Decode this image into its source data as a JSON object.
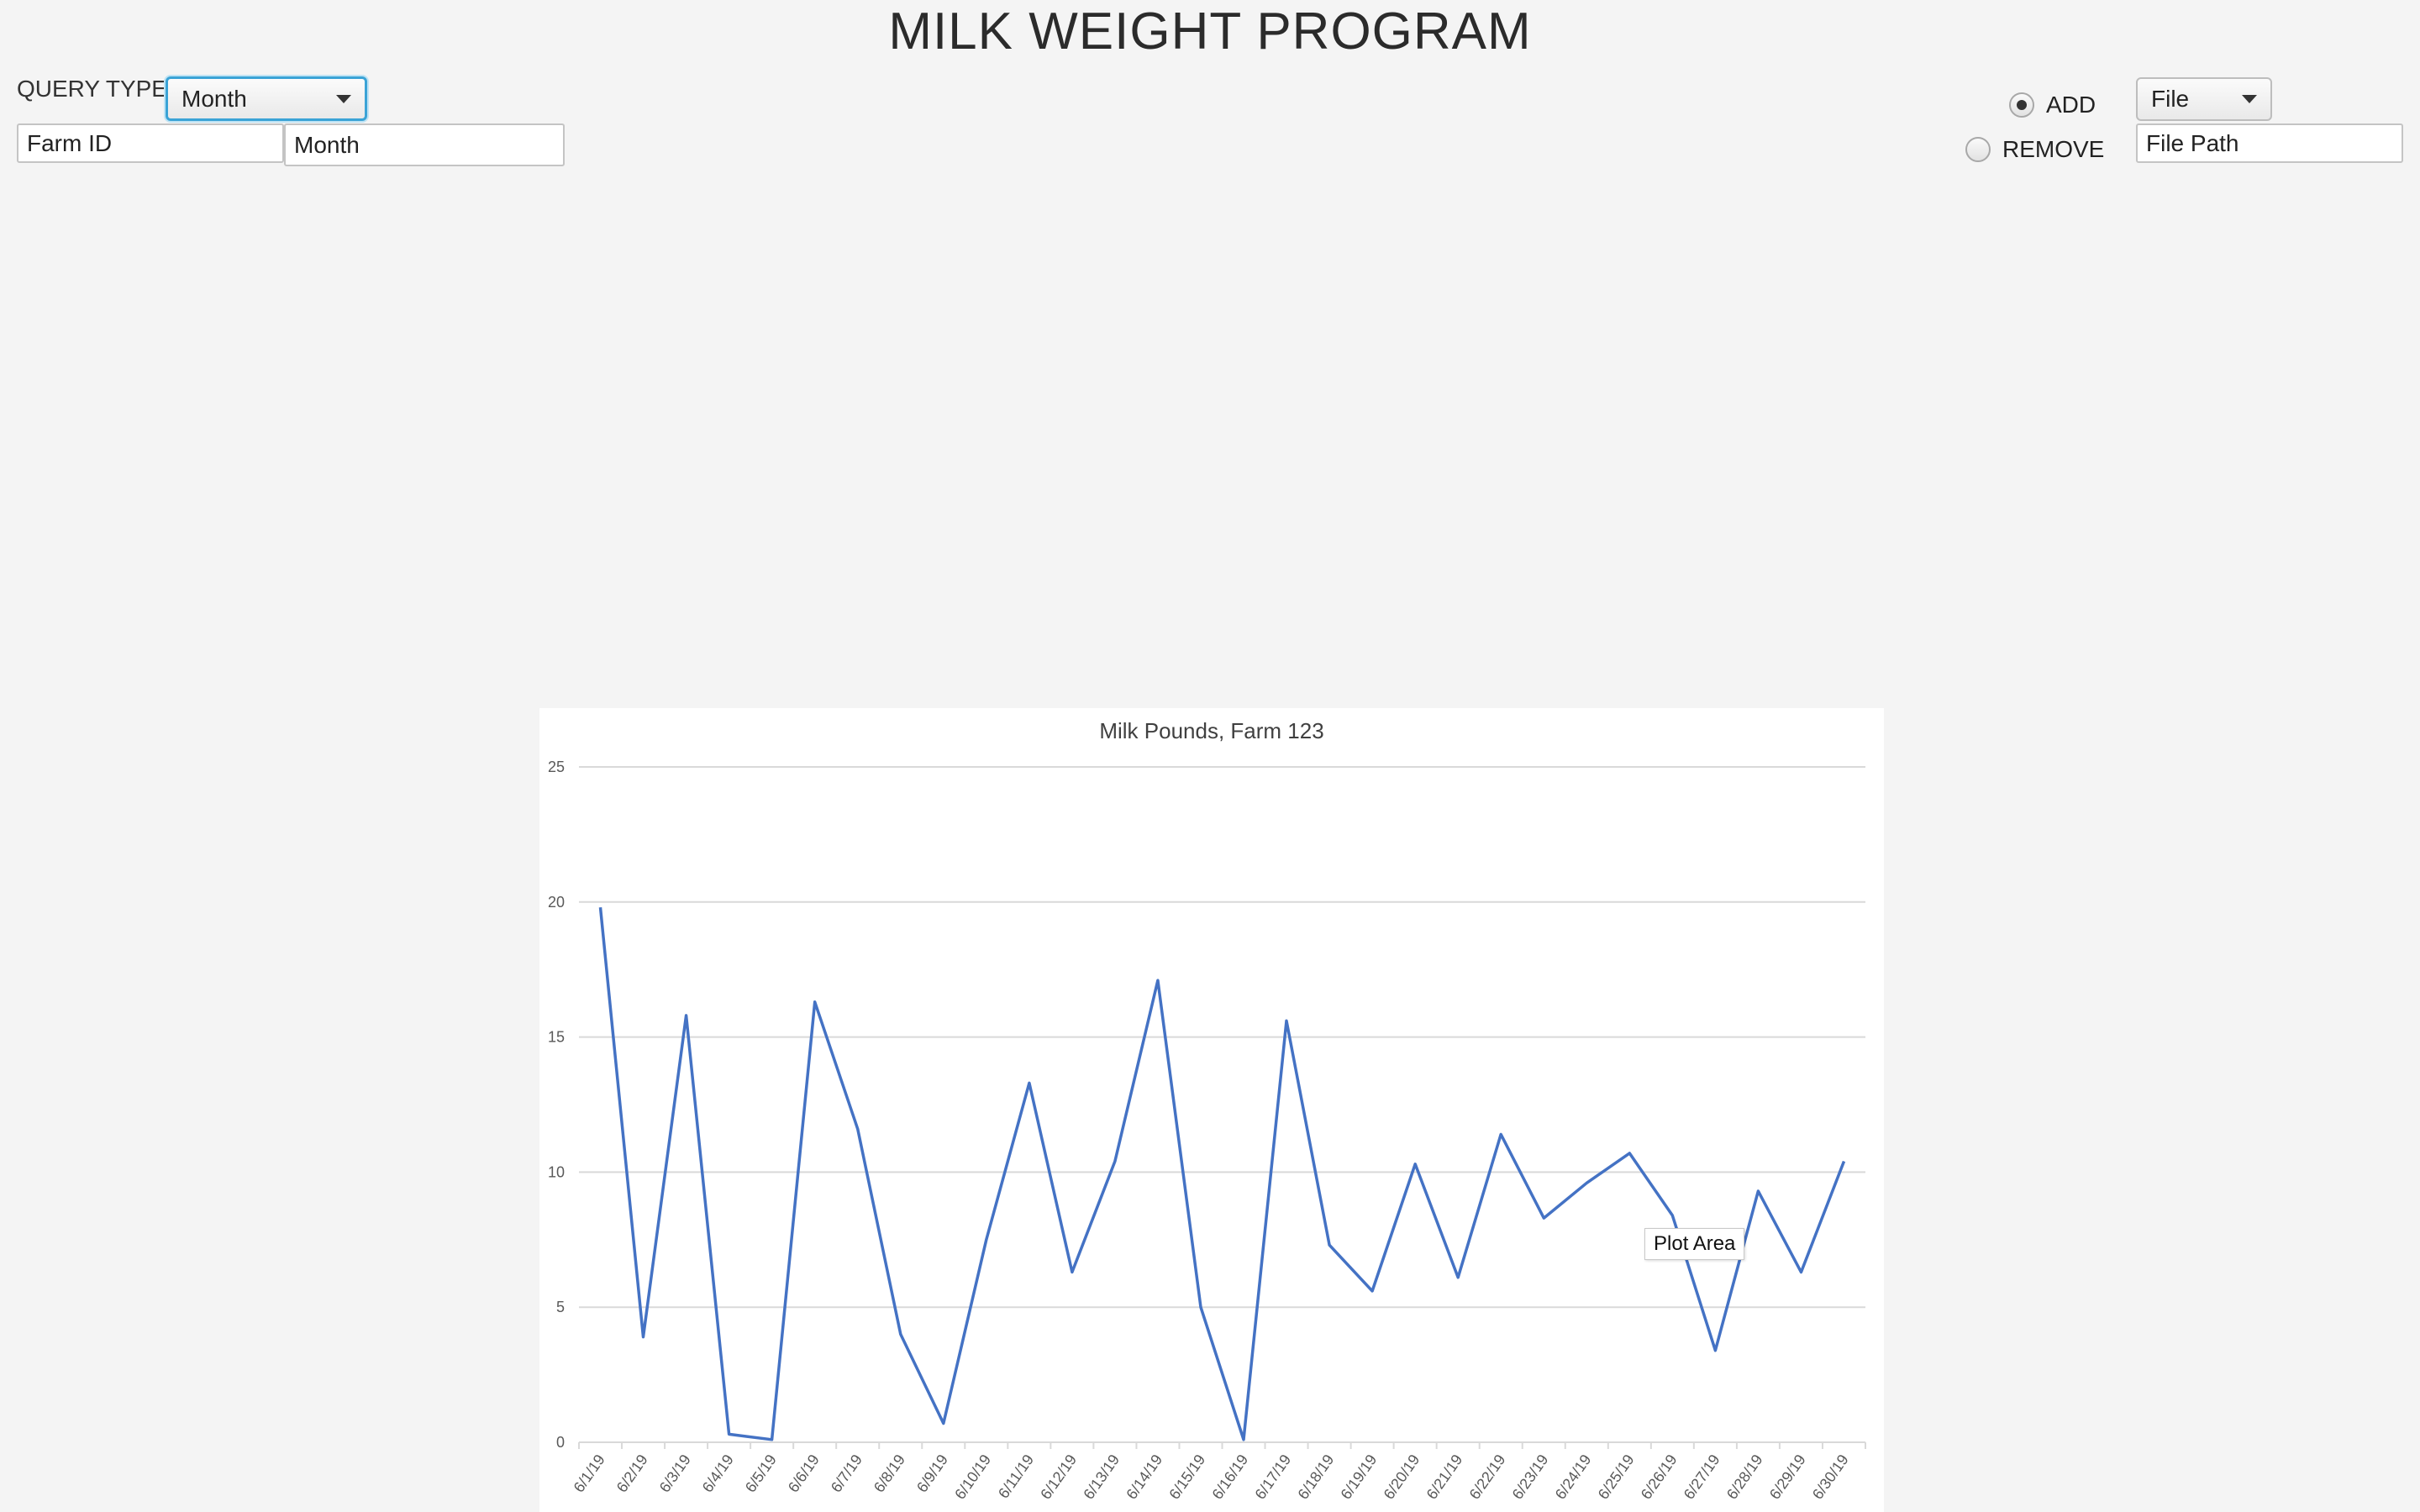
{
  "header": {
    "title": "MILK WEIGHT PROGRAM"
  },
  "query": {
    "label": "QUERY TYPE:",
    "selected": "Month",
    "farm_id_placeholder": "Farm ID",
    "month_placeholder": "Month"
  },
  "edit": {
    "add_label": "ADD",
    "remove_label": "REMOVE",
    "add_checked": true,
    "source_selected": "File",
    "file_path_placeholder": "File Path"
  },
  "tooltip": {
    "text": "Plot Area"
  },
  "chart_data": {
    "type": "line",
    "title": "Milk Pounds, Farm 123",
    "xlabel": "",
    "ylabel": "",
    "ylim": [
      0,
      25
    ],
    "yticks": [
      0,
      5,
      10,
      15,
      20,
      25
    ],
    "grid": true,
    "categories": [
      "6/1/19",
      "6/2/19",
      "6/3/19",
      "6/4/19",
      "6/5/19",
      "6/6/19",
      "6/7/19",
      "6/8/19",
      "6/9/19",
      "6/10/19",
      "6/11/19",
      "6/12/19",
      "6/13/19",
      "6/14/19",
      "6/15/19",
      "6/16/19",
      "6/17/19",
      "6/18/19",
      "6/19/19",
      "6/20/19",
      "6/21/19",
      "6/22/19",
      "6/23/19",
      "6/24/19",
      "6/25/19",
      "6/26/19",
      "6/27/19",
      "6/28/19",
      "6/29/19",
      "6/30/19"
    ],
    "series": [
      {
        "values": [
          19.8,
          3.9,
          15.8,
          0.3,
          0.1,
          16.3,
          11.6,
          4.0,
          0.7,
          7.5,
          13.3,
          6.3,
          10.4,
          17.1,
          5.0,
          0.1,
          15.6,
          7.3,
          5.6,
          10.3,
          6.1,
          11.4,
          8.3,
          9.6,
          10.7,
          8.4,
          3.4,
          9.3,
          6.3,
          10.4
        ]
      }
    ],
    "color": "#4472c4"
  }
}
